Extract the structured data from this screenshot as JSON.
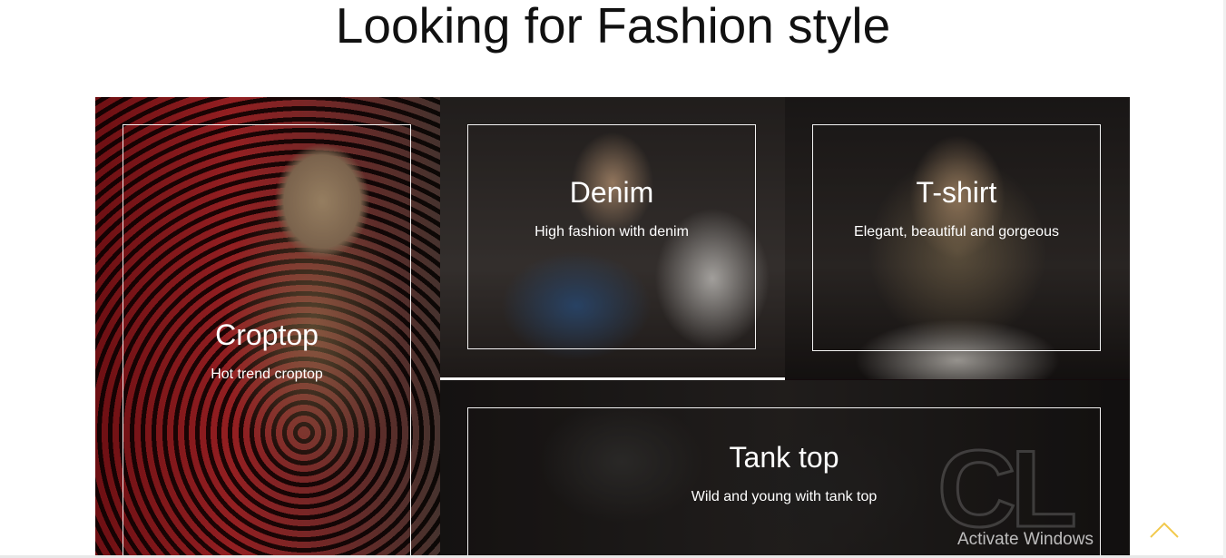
{
  "page": {
    "title": "Looking for Fashion style"
  },
  "categories": [
    {
      "title": "Croptop",
      "description": "Hot trend croptop"
    },
    {
      "title": "Denim",
      "description": "High fashion with denim"
    },
    {
      "title": "T-shirt",
      "description": "Elegant, beautiful and gorgeous"
    },
    {
      "title": "Tank top",
      "description": "Wild and young with tank top"
    }
  ],
  "tanktop_logo": "CL",
  "back_to_top": {
    "icon": "chevron-up-icon",
    "color": "#f2c94c"
  },
  "overlay": {
    "watermark": "Activate Windows"
  }
}
